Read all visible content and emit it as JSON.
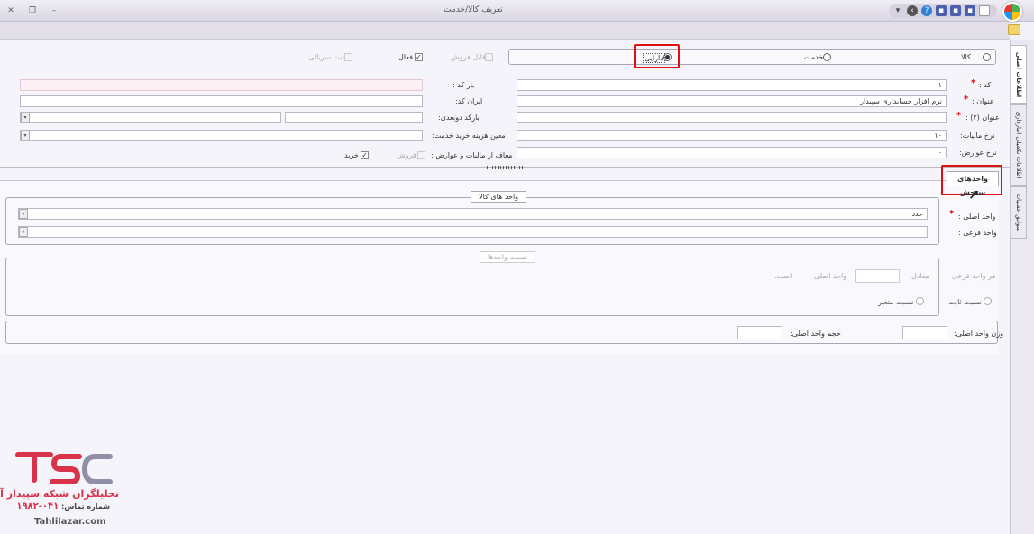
{
  "window": {
    "title": "تعریف کالا/خدمت"
  },
  "type_options": {
    "kala": "کالا",
    "khedmat": "خدمت",
    "darayi": "دارایی"
  },
  "flags": {
    "qabel_forush": "قابل فروش",
    "faal": "فعال",
    "sabt_seriyali": "ثبت سریالی"
  },
  "form": {
    "code_label": "کد :",
    "code_value": "۱",
    "title_label": "عنوان :",
    "title_value": "نرم افزار حسابداری سپیدار",
    "title2_label": "عنوان (۲) :",
    "tax_rate_label": "نرخ مالیات:",
    "tax_rate_value": "۱۰",
    "duties_rate_label": "نرخ عوارض:",
    "duties_rate_value": "۰",
    "barcode_label": "بار کد :",
    "irancode_label": "ایران کد:",
    "barcode2_label": "بارکد دوبعدی:",
    "cost_label": "معین هزینه خرید خدمت:",
    "exempt_label": "معاف از مالیات و عوارض :",
    "sale_label": "فروش",
    "buy_label": "خرید"
  },
  "sidetabs": [
    "اطلاعات اصلی",
    "اطلاعات تکمیلی انبارداری",
    "سوابق عملیات"
  ],
  "units_tab_label": "واحدهای سنجش",
  "units_group": {
    "title": "واحد های کالا",
    "main_label": "واحد اصلی :",
    "main_value": "عدد",
    "sub_label": "واحد فرعی :"
  },
  "ratio_group": {
    "title": "نسبت واحدها",
    "each_sub_label": "هر واحد فرعی",
    "equal_label": "معادل",
    "main_unit_label": "واحد اصلی",
    "is_label": "است.",
    "fixed_label": "نسبت ثابت",
    "variable_label": "نسبت متغیر"
  },
  "weight_group": {
    "weight_label": "وزن واحد اصلی:",
    "volume_label": "حجم واحد اصلی:"
  },
  "watermark": {
    "company": "تحلیلگران شبکه سپیدار آذر",
    "phone_label": "شماره تماس:",
    "phone": "۰۴۱-۱۹۸۲",
    "site": "Tahlilazar.com"
  },
  "colors": {
    "accent_red": "#e01010",
    "window_bg": "#f6f4fb"
  }
}
